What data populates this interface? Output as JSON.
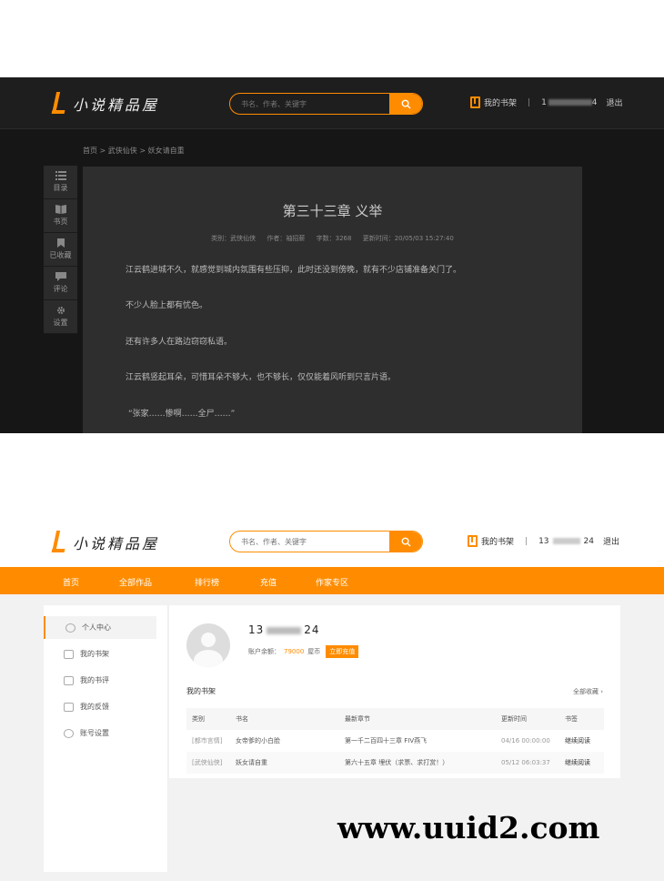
{
  "top": {
    "logo_text": "小说精品屋",
    "search_placeholder": "书名、作者、关键字",
    "shelf_label": "我的书架",
    "user_prefix": "1",
    "user_suffix": "4",
    "logout": "退出",
    "breadcrumb": "首页 > 武侠仙侠 > 妖女请自重",
    "tools": [
      {
        "label": "目录",
        "icon": "list-icon"
      },
      {
        "label": "书页",
        "icon": "book-icon"
      },
      {
        "label": "已收藏",
        "icon": "bookmark-icon"
      },
      {
        "label": "评论",
        "icon": "comment-icon"
      },
      {
        "label": "设置",
        "icon": "gear-icon"
      }
    ],
    "chapter_title": "第三十三章 义举",
    "meta": {
      "category": "类别：武侠仙侠",
      "author": "作者：袖招薪",
      "words": "字数：3268",
      "updated": "更新时间：20/05/03 15:27:40"
    },
    "paragraphs": [
      "江云鹤进城不久，就感觉到城内氛围有些压抑，此时还没到傍晚，就有不少店铺准备关门了。",
      "不少人脸上都有忧色。",
      "还有许多人在路边窃窃私语。",
      "江云鹤竖起耳朵，可惜耳朵不够大，也不够长，仅仅能着风听到只言片语。",
      "“张家……惨啊……全尸……”"
    ]
  },
  "bottom": {
    "logo_text": "小说精品屋",
    "search_placeholder": "书名、作者、关键字",
    "shelf_label": "我的书架",
    "user_prefix": "13",
    "user_suffix": "24",
    "logout": "退出",
    "nav": [
      "首页",
      "全部作品",
      "排行榜",
      "充值",
      "作家专区"
    ],
    "sidebar": [
      {
        "label": "个人中心",
        "icon": "user-icon"
      },
      {
        "label": "我的书架",
        "icon": "shelf-icon"
      },
      {
        "label": "我的书评",
        "icon": "review-icon"
      },
      {
        "label": "我的反馈",
        "icon": "mail-icon"
      },
      {
        "label": "账号设置",
        "icon": "gear-icon"
      }
    ],
    "username_prefix": "13",
    "username_suffix": "24",
    "balance_label": "账户余额：",
    "balance_amount": "79000",
    "balance_unit": "屋币",
    "recharge_button": "立即充值",
    "shelf_title": "我的书架",
    "shelf_all": "全部收藏 ›",
    "table_headers": [
      "类别",
      "书名",
      "最新章节",
      "更新时间",
      "书签"
    ],
    "rows": [
      {
        "category": "[都市言情]",
        "name": "女帝爹的小白脸",
        "chapter": "第一千二百四十三章 FIV燕飞",
        "time": "04/16 00:00:00",
        "action": "继续阅读"
      },
      {
        "category": "[武侠仙侠]",
        "name": "妖女请自重",
        "chapter": "第六十五章 埋伏（求票、求打赏！）",
        "time": "05/12 06:03:37",
        "action": "继续阅读"
      }
    ]
  },
  "watermark": "www.uuid2.com",
  "colors": {
    "accent": "#ff8c00",
    "dark_bg": "#161616",
    "reader_bg": "#2e2e2e"
  }
}
